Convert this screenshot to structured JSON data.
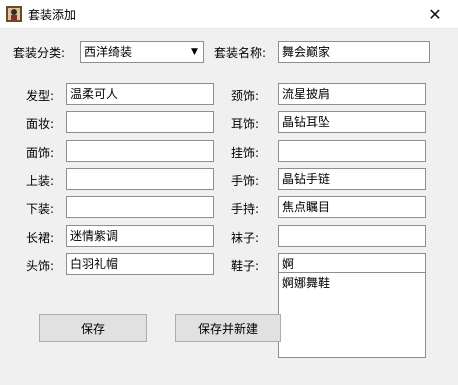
{
  "window": {
    "title": "套装添加",
    "close": "✕"
  },
  "category": {
    "label": "套装分类:",
    "value": "西洋绮装"
  },
  "suit_name": {
    "label": "套装名称:",
    "value": "舞会巅家"
  },
  "fields": {
    "hair": {
      "label": "发型:",
      "value": "温柔可人"
    },
    "makeup": {
      "label": "面妆:",
      "value": ""
    },
    "face_acc": {
      "label": "面饰:",
      "value": ""
    },
    "top": {
      "label": "上装:",
      "value": ""
    },
    "bottom": {
      "label": "下装:",
      "value": ""
    },
    "long_skirt": {
      "label": "长裙:",
      "value": "迷情紫调"
    },
    "head_acc": {
      "label": "头饰:",
      "value": "白羽礼帽"
    },
    "neck_acc": {
      "label": "颈饰:",
      "value": "流星披肩"
    },
    "ear_acc": {
      "label": "耳饰:",
      "value": "晶钻耳坠"
    },
    "hanging_acc": {
      "label": "挂饰:",
      "value": ""
    },
    "hand_acc": {
      "label": "手饰:",
      "value": "晶钻手链"
    },
    "handheld": {
      "label": "手持:",
      "value": "焦点瞩目"
    },
    "socks": {
      "label": "袜子:",
      "value": ""
    },
    "shoes": {
      "label": "鞋子:",
      "value": "婀"
    }
  },
  "suggestions": [
    "婀娜舞鞋"
  ],
  "buttons": {
    "save": "保存",
    "save_new": "保存并新建"
  }
}
